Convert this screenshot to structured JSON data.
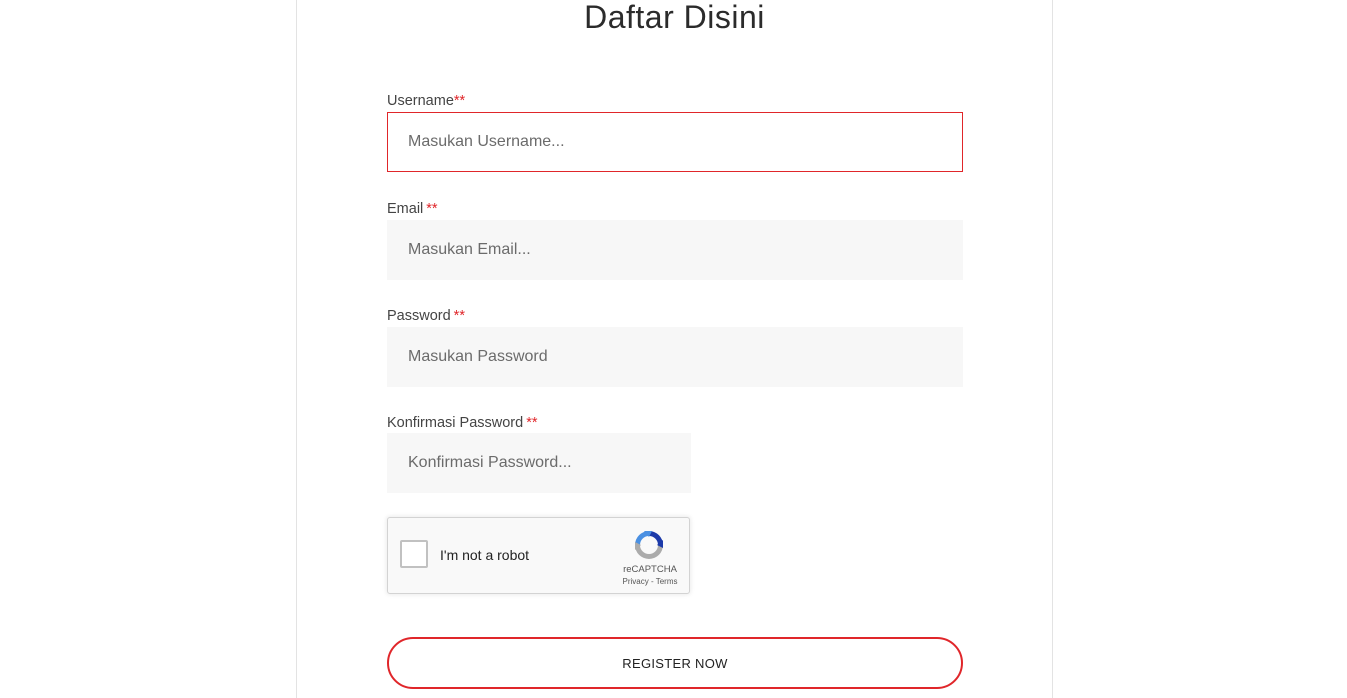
{
  "page": {
    "title": "Daftar Disini"
  },
  "form": {
    "username": {
      "label": "Username",
      "required_mark": "**",
      "placeholder": "Masukan Username...",
      "value": ""
    },
    "email": {
      "label": "Email",
      "required_mark": "**",
      "placeholder": "Masukan Email...",
      "value": ""
    },
    "password": {
      "label": "Password",
      "required_mark": "**",
      "placeholder": "Masukan Password",
      "value": ""
    },
    "confirm_password": {
      "label": "Konfirmasi Password",
      "required_mark": "**",
      "placeholder": "Konfirmasi Password...",
      "value": ""
    },
    "recaptcha": {
      "text": "I'm not a robot",
      "brand": "reCAPTCHA",
      "links": "Privacy - Terms",
      "checked": false,
      "icon": "recaptcha-logo-icon"
    },
    "submit_label": "REGISTER NOW"
  },
  "colors": {
    "accent": "#e0262a",
    "field_background": "#f7f7f7",
    "recaptcha_blue": "#1c3aa9",
    "recaptcha_light_blue": "#4a90e2",
    "recaptcha_gray": "#ababab"
  }
}
